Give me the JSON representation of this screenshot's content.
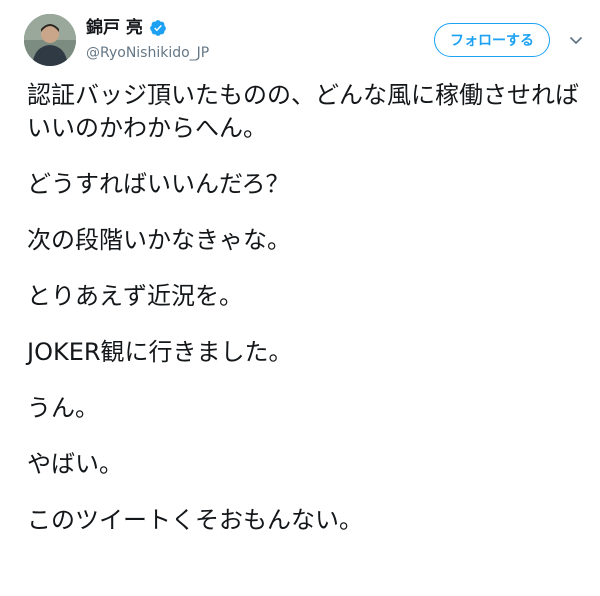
{
  "author": {
    "display_name": "錦戸 亮",
    "handle": "@RyoNishikido_JP",
    "verified": true
  },
  "actions": {
    "follow_label": "フォローする"
  },
  "icons": {
    "verified": "verified-badge-icon",
    "caret": "chevron-down-icon"
  },
  "colors": {
    "accent": "#1da1f2",
    "text": "#14171a",
    "secondary": "#657786"
  },
  "tweet": {
    "paragraphs": [
      "認証バッジ頂いたものの、どんな風に稼働させればいいのかわからへん。",
      "どうすればいいんだろ？",
      "次の段階いかなきゃな。",
      "とりあえず近況を。",
      "JOKER観に行きました。",
      "うん。",
      "やばい。",
      "このツイートくそおもんない。"
    ]
  }
}
